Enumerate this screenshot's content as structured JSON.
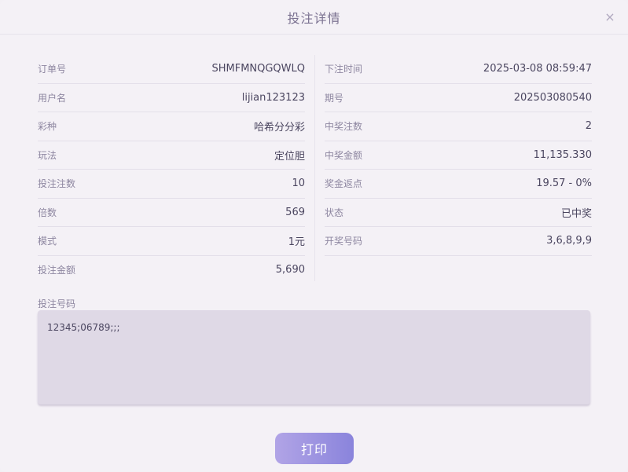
{
  "dialog": {
    "title": "投注详情",
    "close_glyph": "×"
  },
  "left_fields": [
    {
      "label": "订单号",
      "value": "SHMFMNQGQWLQ"
    },
    {
      "label": "用户名",
      "value": "lijian123123"
    },
    {
      "label": "彩种",
      "value": "哈希分分彩"
    },
    {
      "label": "玩法",
      "value": "定位胆"
    },
    {
      "label": "投注注数",
      "value": "10"
    },
    {
      "label": "倍数",
      "value": "569"
    },
    {
      "label": "模式",
      "value": "1元"
    },
    {
      "label": "投注金额",
      "value": "5,690"
    }
  ],
  "right_fields": [
    {
      "label": "下注时间",
      "value": "2025-03-08 08:59:47"
    },
    {
      "label": "期号",
      "value": "202503080540"
    },
    {
      "label": "中奖注数",
      "value": "2"
    },
    {
      "label": "中奖金额",
      "value": "11,135.330"
    },
    {
      "label": "奖金返点",
      "value": "19.57 - 0%"
    },
    {
      "label": "状态",
      "value": "已中奖"
    },
    {
      "label": "开奖号码",
      "value": "3,6,8,9,9"
    }
  ],
  "bet_numbers": {
    "label": "投注号码",
    "value": "12345;06789;;;"
  },
  "actions": {
    "print_label": "打印"
  },
  "icons": {
    "close": "close-icon"
  },
  "colors": {
    "accent_start": "#b1a4e6",
    "accent_end": "#8a84dc",
    "background": "#f4f1f6",
    "textarea_bg": "#dfd9e6"
  }
}
